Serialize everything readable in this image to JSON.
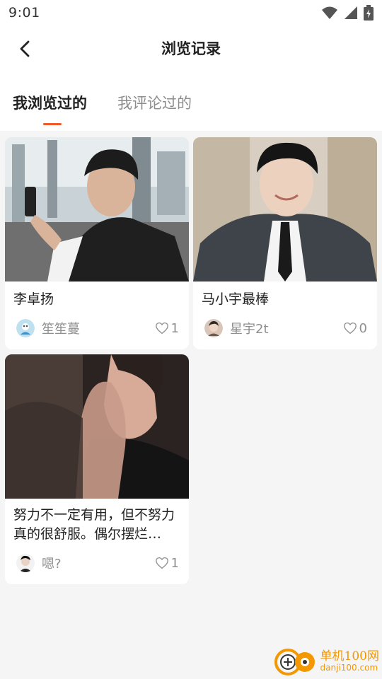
{
  "status_bar": {
    "time": "9:01"
  },
  "nav": {
    "title": "浏览记录"
  },
  "tabs": [
    {
      "label": "我浏览过的",
      "active": true
    },
    {
      "label": "我评论过的",
      "active": false
    }
  ],
  "cards": [
    {
      "title": "李卓扬",
      "author": "笙笙蔓",
      "likes": "1"
    },
    {
      "title": "马小宇最棒",
      "author": "星宇2t",
      "likes": "0"
    },
    {
      "title": "努力不一定有用，但不努力真的很舒服。偶尔摆烂…",
      "author": "嗯?",
      "likes": "1"
    }
  ],
  "watermark": {
    "cn": "单机100网",
    "en": "danji100.com"
  },
  "colors": {
    "accent": "#f05a28",
    "watermark": "#f39800"
  }
}
